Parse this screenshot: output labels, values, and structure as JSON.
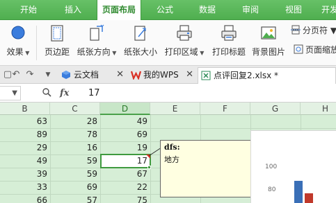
{
  "menu": {
    "tabs": [
      {
        "label": "开始",
        "active": false
      },
      {
        "label": "插入",
        "active": false
      },
      {
        "label": "页面布局",
        "active": true
      },
      {
        "label": "公式",
        "active": false
      },
      {
        "label": "数据",
        "active": false
      },
      {
        "label": "审阅",
        "active": false
      },
      {
        "label": "视图",
        "active": false
      },
      {
        "label": "开发",
        "active": false
      }
    ]
  },
  "ribbon": {
    "effects_label": "效果",
    "margins_label": "页边距",
    "orientation_label": "纸张方向",
    "size_label": "纸张大小",
    "print_area_label": "打印区域",
    "print_titles_label": "打印标题",
    "background_label": "背景图片",
    "page_break_label": "分页符",
    "page_zoom_label": "页面缩放"
  },
  "doc_tabs": [
    {
      "label": "云文档",
      "icon": "cloud-doc-icon",
      "active": false
    },
    {
      "label": "我的WPS",
      "icon": "wps-logo-icon",
      "active": false
    },
    {
      "label": "点评回复2.xlsx *",
      "icon": "spreadsheet-icon",
      "active": true
    }
  ],
  "formula_bar": {
    "name_box_value": "",
    "formula_value": "17",
    "fx_label": "fx"
  },
  "grid": {
    "columns": [
      "B",
      "C",
      "D",
      "E",
      "F",
      "G",
      "H"
    ],
    "active_column": "D",
    "rows": [
      {
        "B": "63",
        "C": "28",
        "D": "49"
      },
      {
        "B": "89",
        "C": "78",
        "D": "69"
      },
      {
        "B": "29",
        "C": "16",
        "D": "19"
      },
      {
        "B": "49",
        "C": "59",
        "D": "17"
      },
      {
        "B": "39",
        "C": "59",
        "D": "67"
      },
      {
        "B": "33",
        "C": "69",
        "D": "22"
      },
      {
        "B": "66",
        "C": "57",
        "D": "75"
      }
    ],
    "selected_row_index": 3
  },
  "comment": {
    "author": "dfs:",
    "text": "地方"
  },
  "chart_data": {
    "type": "bar",
    "yticks": [
      "100",
      "80"
    ],
    "bar_colors": [
      "#3a6fb7",
      "#c0392b"
    ]
  },
  "colors": {
    "accent_green": "#4fae4f",
    "grid_bg": "#d6eed6",
    "comment_bg": "#ffffe1"
  }
}
